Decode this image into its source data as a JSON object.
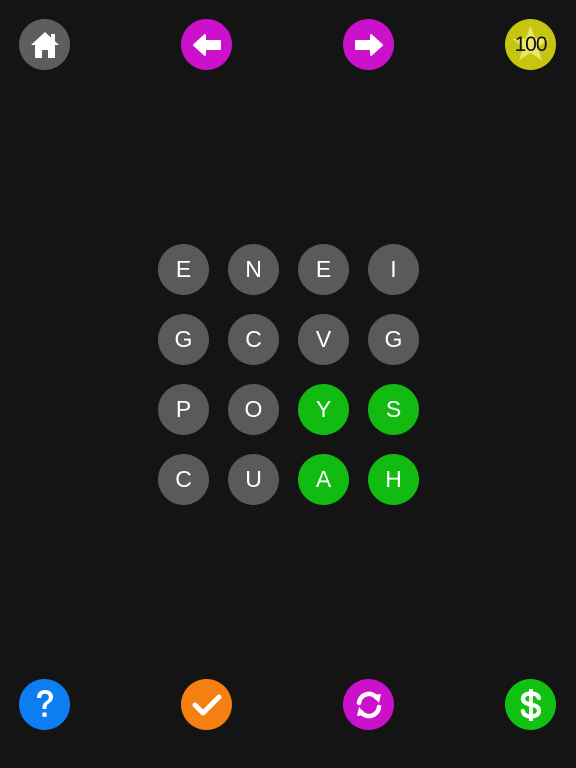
{
  "header": {
    "home_icon": "home-icon",
    "prev_icon": "arrow-left-icon",
    "next_icon": "arrow-right-icon",
    "coins_icon": "star-icon",
    "coins": "100"
  },
  "board": {
    "tiles": [
      {
        "letter": "E",
        "selected": false
      },
      {
        "letter": "N",
        "selected": false
      },
      {
        "letter": "E",
        "selected": false
      },
      {
        "letter": "I",
        "selected": false
      },
      {
        "letter": "G",
        "selected": false
      },
      {
        "letter": "C",
        "selected": false
      },
      {
        "letter": "V",
        "selected": false
      },
      {
        "letter": "G",
        "selected": false
      },
      {
        "letter": "P",
        "selected": false
      },
      {
        "letter": "O",
        "selected": false
      },
      {
        "letter": "Y",
        "selected": true
      },
      {
        "letter": "S",
        "selected": true
      },
      {
        "letter": "C",
        "selected": false
      },
      {
        "letter": "U",
        "selected": false
      },
      {
        "letter": "A",
        "selected": true
      },
      {
        "letter": "H",
        "selected": true
      }
    ]
  },
  "footer": {
    "help_icon": "question-icon",
    "check_icon": "checkmark-icon",
    "shuffle_icon": "refresh-icon",
    "shop_icon": "dollar-icon"
  },
  "colors": {
    "background": "#141414",
    "tile": "#5a5a5a",
    "tile_selected": "#11bb11",
    "home": "#5e5e5e",
    "arrows": "#cc11cc",
    "coins": "#c6c610",
    "help": "#0c7ef2",
    "check": "#f67f12",
    "shop": "#12c212"
  }
}
